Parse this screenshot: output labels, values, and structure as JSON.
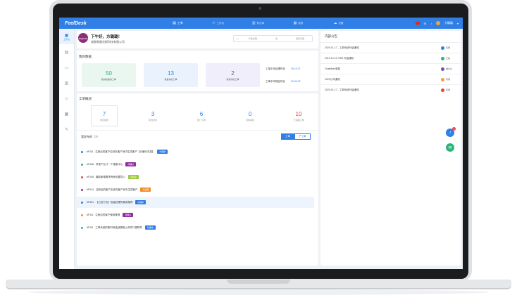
{
  "app": {
    "logo": "FeelDesk"
  },
  "topnav": [
    {
      "label": "工单",
      "icon": "ticket-icon",
      "active": true
    },
    {
      "label": "工作台",
      "icon": "user-icon",
      "active": false
    },
    {
      "label": "知识库",
      "icon": "book-icon",
      "active": false
    },
    {
      "label": "报表",
      "icon": "chart-icon",
      "active": false
    },
    {
      "label": "设置",
      "icon": "cloud-icon",
      "active": false
    }
  ],
  "topbar_right": {
    "user_name": "方璐璐"
  },
  "sidebar": {
    "items": [
      {
        "label": "工作台",
        "icon": "desk-icon"
      },
      {
        "label": "",
        "icon": "doc-icon"
      },
      {
        "label": "",
        "icon": "folder-icon"
      },
      {
        "label": "",
        "icon": "stats-icon"
      },
      {
        "label": "",
        "icon": "diamond-icon"
      },
      {
        "label": "",
        "icon": "grid-icon"
      },
      {
        "label": "",
        "icon": "wrench-icon"
      }
    ]
  },
  "greeting": {
    "text": "下午好，方璐璐！",
    "company": "成都易隆克斯科技有限公司",
    "avatar_text": "eqcom"
  },
  "time_range": {
    "start": "开始日期",
    "sep": "至",
    "end": "结束日期"
  },
  "my_data": {
    "title": "我的数据",
    "stats": [
      {
        "value": "50",
        "label": "指派给我的工单",
        "color": "#2db37a",
        "bg": "#e9f7f0"
      },
      {
        "value": "13",
        "label": "我发布的工单",
        "color": "#2f7fe6",
        "bg": "#eaf2fd"
      },
      {
        "value": "2",
        "label": "我协作的工单",
        "color": "#6b4fbb",
        "bg": "#f1eefb"
      }
    ],
    "avg_handle_label": "工单平均处理时长",
    "avg_handle_value": "30:10:27",
    "avg_response_label": "工单平均响应时长",
    "avg_response_value": "00:09:02"
  },
  "overview": {
    "title": "工单概况",
    "items": [
      {
        "value": "7",
        "label": "我处理的",
        "color": "#2f7fe6"
      },
      {
        "value": "3",
        "label": "我创建的",
        "color": "#2f7fe6"
      },
      {
        "value": "6",
        "label": "部门工单",
        "color": "#2f7fe6"
      },
      {
        "value": "0",
        "label": "待我审核",
        "color": "#2f7fe6"
      },
      {
        "value": "10",
        "label": "已逾期工单",
        "color": "#e94040"
      }
    ]
  },
  "tickets": {
    "title": "我发布的（7）",
    "toggle_on": "工单",
    "toggle_off": "子工单",
    "rows": [
      {
        "text": "#F111 . 注册后的客户应该在客户池中生成客户【已编行去重】",
        "badge": "处理中",
        "badge_color": "#2f7fe6",
        "dot": "#2f7fe6"
      },
      {
        "text": "#F136 . 时常产业计一个搜索中心",
        "badge": "待确认",
        "badge_color": "#8e2d9e",
        "dot": "#2db37a"
      },
      {
        "text": "#F145 . 增能新增需求有两页置导入",
        "badge": "待验证",
        "badge_color": "#9acb3c",
        "dot": "#e94040"
      },
      {
        "text": "#F014 . 注册后的客户应该在客户池中生成客户",
        "badge": "已逾期",
        "badge_color": "#f08a24",
        "dot": "#8e2d9e"
      },
      {
        "text": "#F401 . 【已处行去】批量处理的使用推荐",
        "badge": "处理中",
        "badge_color": "#2f7fe6",
        "dot": "#2f7fe6",
        "highlight": true
      },
      {
        "text": "#F111 . 注册后的客户使用推荐",
        "badge": "待确认",
        "badge_color": "#8e2d9e",
        "dot": "#f08a24"
      },
      {
        "text": "#F111 . 工单系统的新时间连续提案上有并行视附件",
        "badge": "处理中",
        "badge_color": "#2f7fe6",
        "dot": "#2bb5c7"
      }
    ]
  },
  "announcements": {
    "title": "内部公告",
    "items": [
      {
        "text": "2020.01.17 - 工单系统升级通知",
        "author": "韦博",
        "color": "#2f7fe6"
      },
      {
        "text": "2019.12.11 CRM 升级通知",
        "author": "王峰",
        "color": "#2db37a"
      },
      {
        "text": "ChatMate更新",
        "author": "谢立立",
        "color": "#6b4fbb"
      },
      {
        "text": "2020公司通知",
        "author": "韦博",
        "color": "#f2a23a"
      },
      {
        "text": "2020.01.17 - 工单系统升级通知",
        "author": "韦博",
        "color": "#e94040"
      }
    ]
  },
  "notifications": {
    "count": "2"
  }
}
